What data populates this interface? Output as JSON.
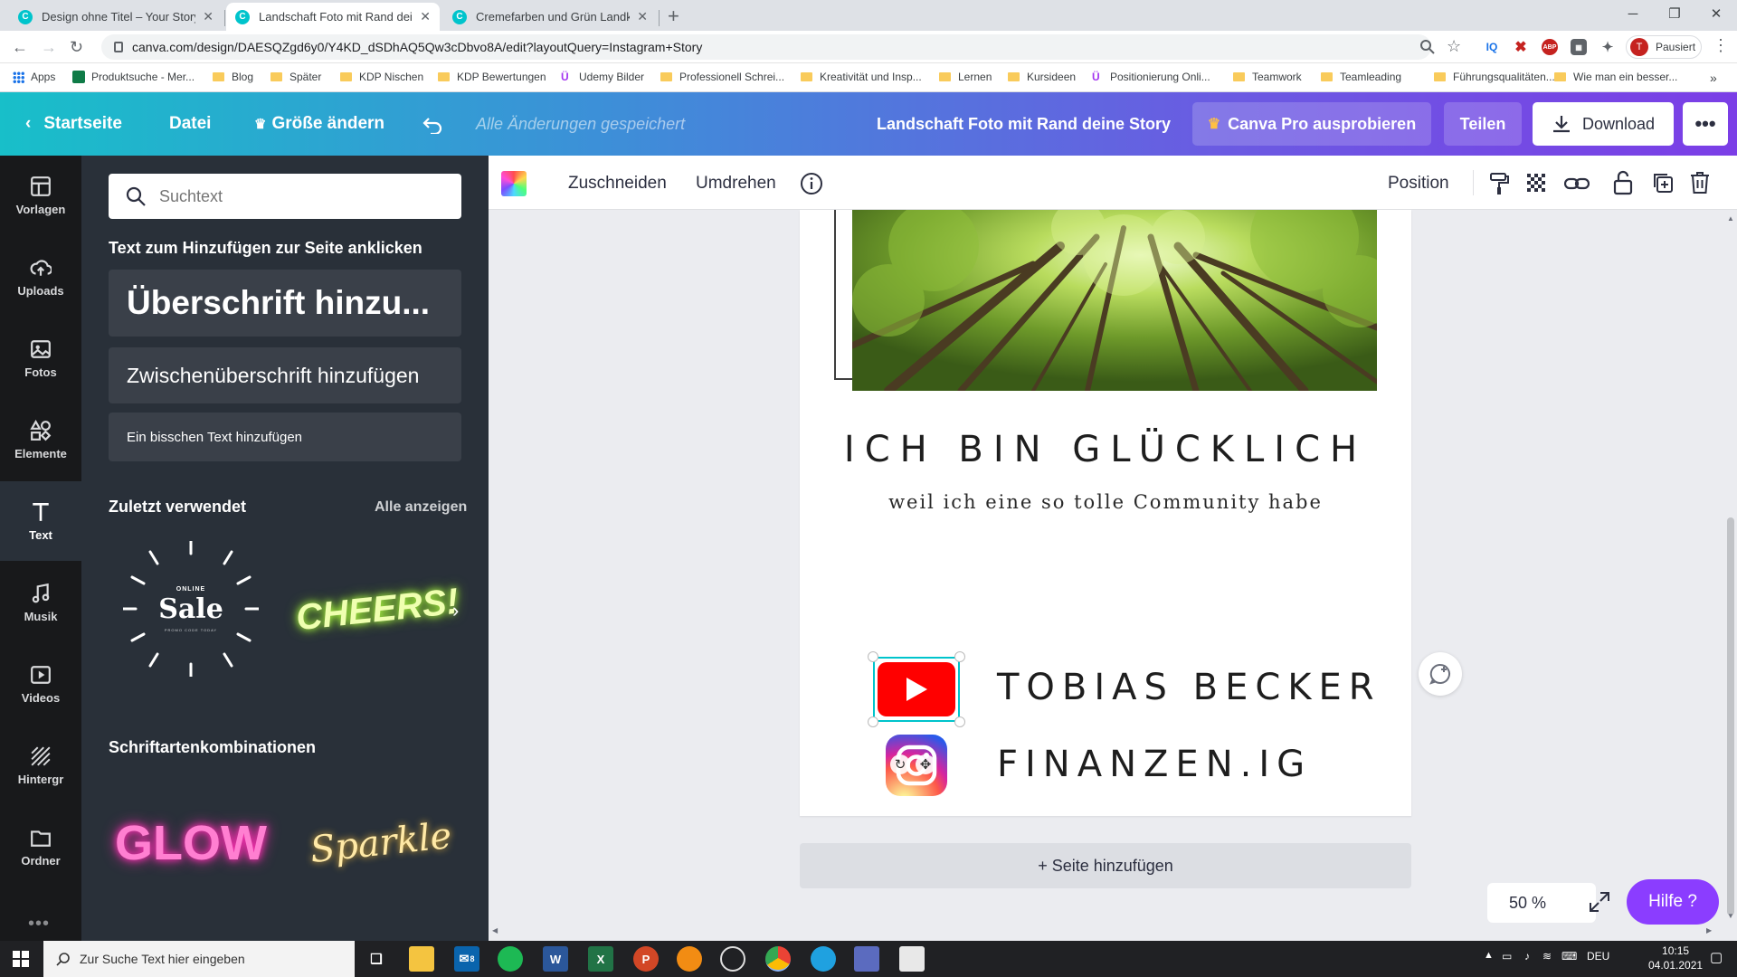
{
  "browser": {
    "tabs": [
      {
        "title": "Design ohne Titel – Your Story",
        "active": false
      },
      {
        "title": "Landschaft Foto mit Rand deine Story",
        "active": true
      },
      {
        "title": "Cremefarben und Grün Landkarte",
        "active": false
      }
    ],
    "new_tab": "+",
    "url": "canva.com/design/DAESQZgd6y0/Y4KD_dSDhAQ5Qw3cDbvo8A/edit?layoutQuery=Instagram+Story",
    "profile_label": "Pausiert",
    "profile_initial": "T",
    "bookmarks": [
      {
        "label": "Apps",
        "icon": "apps-icon"
      },
      {
        "label": "Produktsuche - Mer...",
        "icon": "green-square-icon"
      },
      {
        "label": "Blog",
        "icon": "folder-icon"
      },
      {
        "label": "Später",
        "icon": "folder-icon"
      },
      {
        "label": "KDP Nischen",
        "icon": "folder-icon"
      },
      {
        "label": "KDP Bewertungen",
        "icon": "folder-icon"
      },
      {
        "label": "Udemy Bilder",
        "icon": "udemy-icon"
      },
      {
        "label": "Professionell Schrei...",
        "icon": "folder-icon"
      },
      {
        "label": "Kreativität und Insp...",
        "icon": "folder-icon"
      },
      {
        "label": "Lernen",
        "icon": "folder-icon"
      },
      {
        "label": "Kursideen",
        "icon": "folder-icon"
      },
      {
        "label": "Positionierung Onli...",
        "icon": "udemy-icon"
      },
      {
        "label": "Teamwork",
        "icon": "folder-icon"
      },
      {
        "label": "Teamleading",
        "icon": "folder-icon"
      },
      {
        "label": "Führungsqualitäten...",
        "icon": "folder-icon"
      },
      {
        "label": "Wie man ein besser...",
        "icon": "folder-icon"
      }
    ]
  },
  "header": {
    "home": "Startseite",
    "file": "Datei",
    "resize": "Größe ändern",
    "saved_status": "Alle Änderungen gespeichert",
    "doc_title": "Landschaft Foto mit Rand deine Story",
    "pro": "Canva Pro ausprobieren",
    "share": "Teilen",
    "download": "Download",
    "more": "•••"
  },
  "rail": [
    {
      "label": "Vorlagen",
      "icon": "templates-icon"
    },
    {
      "label": "Uploads",
      "icon": "upload-cloud-icon"
    },
    {
      "label": "Fotos",
      "icon": "photo-icon"
    },
    {
      "label": "Elemente",
      "icon": "elements-icon"
    },
    {
      "label": "Text",
      "icon": "text-icon"
    },
    {
      "label": "Musik",
      "icon": "music-icon"
    },
    {
      "label": "Videos",
      "icon": "video-icon"
    },
    {
      "label": "Hintergr",
      "icon": "background-icon"
    },
    {
      "label": "Ordner",
      "icon": "folder-icon"
    }
  ],
  "rail_active": "Text",
  "rail_more": "•••",
  "panel": {
    "search_placeholder": "Suchtext",
    "click_to_add": "Text zum Hinzufügen zur Seite anklicken",
    "heading": "Überschrift hinzu...",
    "subheading": "Zwischenüberschrift hinzufügen",
    "body": "Ein bisschen Text hinzufügen",
    "recent": "Zuletzt verwendet",
    "see_all": "Alle anzeigen",
    "recent_items": {
      "sale_top": "ONLINE",
      "sale_main": "Sale",
      "sale_bottom": "PROMO CODE TODAY",
      "cheers": "CHEERS!"
    },
    "font_combos": "Schriftartenkombinationen",
    "combo_items": {
      "glow": "GLOW",
      "sparkle": "Sparkle"
    }
  },
  "toolbar": {
    "crop": "Zuschneiden",
    "flip": "Umdrehen",
    "position": "Position"
  },
  "canvas": {
    "headline": "ICH BIN GLÜCKLICH",
    "subline": "weil ich eine so tolle Community habe",
    "youtube_name": "TOBIAS BECKER",
    "instagram_name": "FINANZEN.IG",
    "add_page": "+ Seite hinzufügen",
    "zoom": "50 %",
    "help": "Hilfe ?"
  },
  "taskbar": {
    "search": "Zur Suche Text hier eingeben",
    "mail_badge": "8",
    "lang": "DEU",
    "time": "10:15",
    "date": "04.01.2021"
  },
  "colors": {
    "canva_teal": "#00c4cc",
    "canva_purple": "#8b3dff",
    "panel_bg": "#293039",
    "rail_bg": "#18191b",
    "youtube_red": "#ff0000"
  }
}
